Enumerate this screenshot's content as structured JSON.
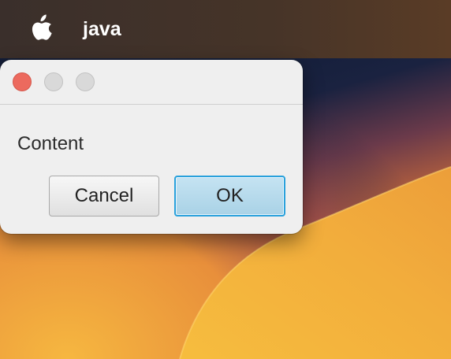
{
  "menubar": {
    "app_name": "java",
    "apple_icon": "apple-logo-icon"
  },
  "dialog": {
    "window_controls": [
      "close-button",
      "minimize-button",
      "zoom-button"
    ],
    "content_text": "Content",
    "buttons": {
      "cancel_label": "Cancel",
      "ok_label": "OK"
    }
  },
  "colors": {
    "close": "#ec6a5e",
    "ok_button": "#aed4e8",
    "ok_border": "#29a1dc",
    "wallpaper_orange": "#f2b33d",
    "wallpaper_navy": "#0b1a33"
  }
}
